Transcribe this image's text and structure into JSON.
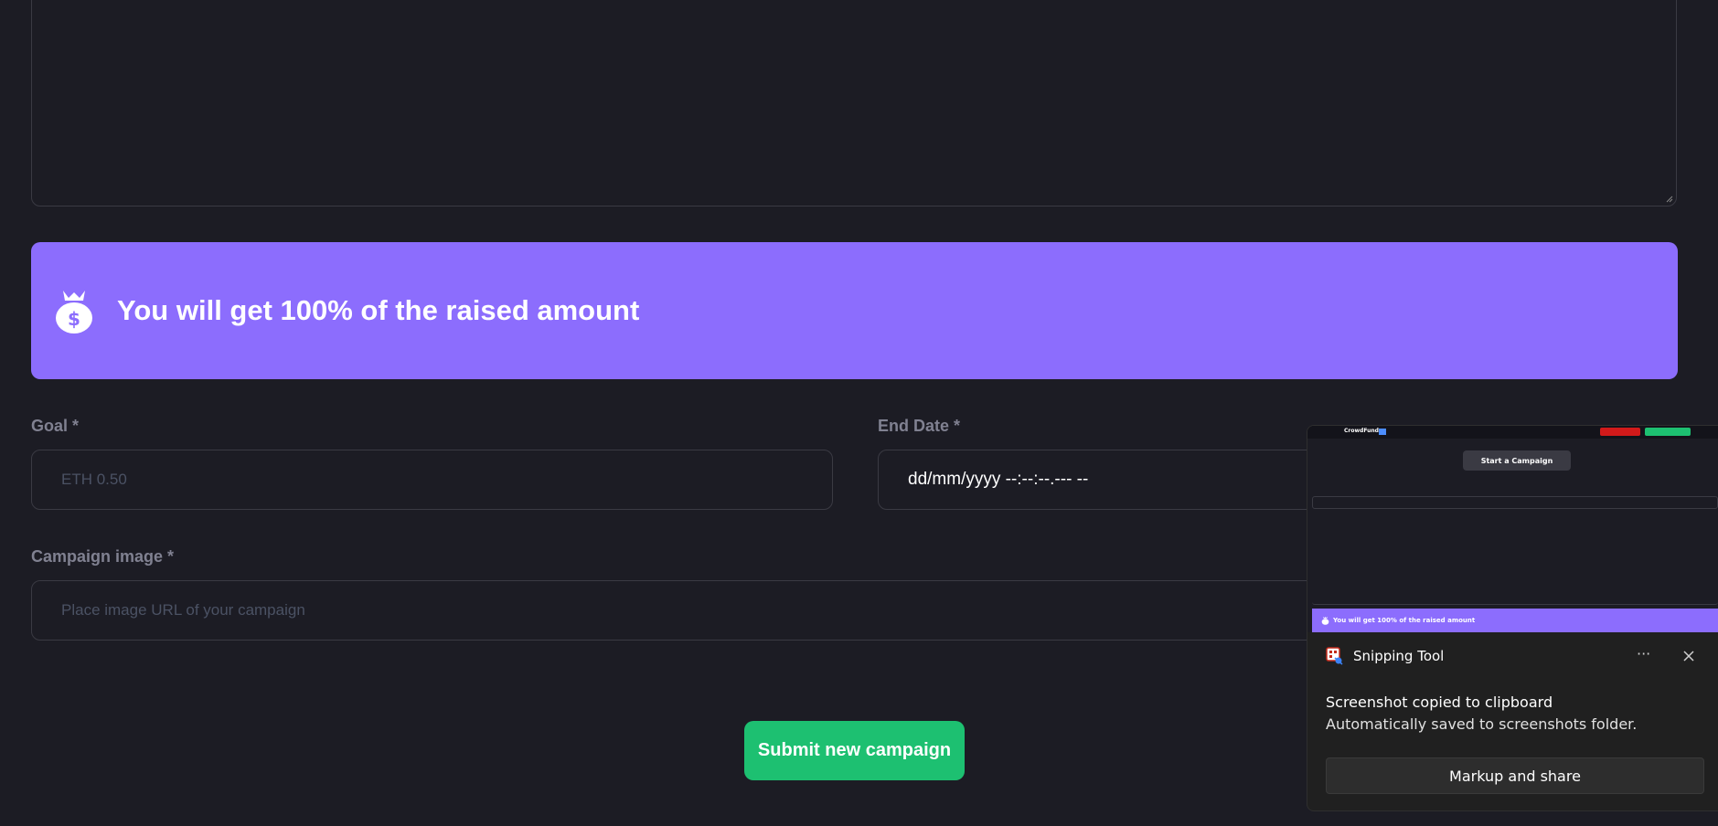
{
  "banner": {
    "text": "You will get 100% of the raised amount"
  },
  "form": {
    "goal_label": "Goal *",
    "goal_placeholder": "ETH 0.50",
    "end_date_label": "End Date *",
    "end_date_value": "dd/mm/yyyy --:--:--.--- --",
    "image_label": "Campaign image *",
    "image_placeholder": "Place image URL of your campaign",
    "submit_label": "Submit new campaign"
  },
  "toast": {
    "app_name": "Snipping Tool",
    "more_label": "···",
    "title": "Screenshot copied to clipboard",
    "body": "Automatically saved to screenshots folder.",
    "action_label": "Markup and share",
    "thumbnail": {
      "logo": "CrowdFund",
      "heading": "Start a Campaign",
      "banner_text": "You will get 100% of the raised amount"
    }
  },
  "colors": {
    "background": "#1c1c24",
    "banner": "#8c6dfd",
    "submit": "#1dc071",
    "label": "#808191",
    "border": "#3a3a43",
    "toast_bg": "#202020"
  }
}
